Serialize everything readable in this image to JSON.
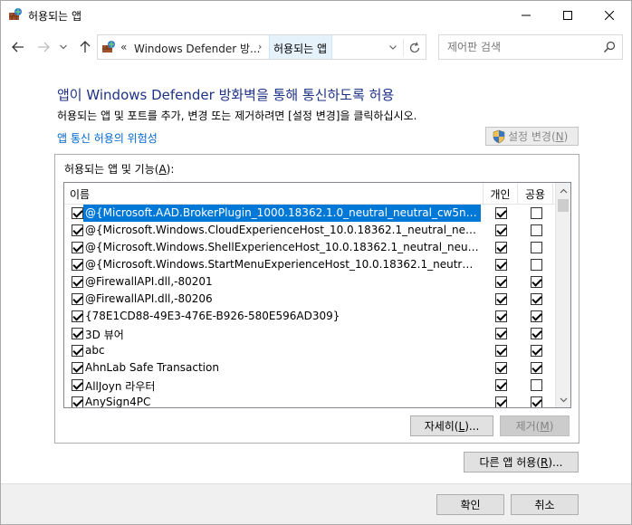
{
  "window": {
    "title": "허용되는 앱",
    "controls": {
      "minimize": "minimize",
      "maximize": "maximize",
      "close": "close"
    }
  },
  "nav": {
    "back_icon": "arrow-left-icon",
    "forward_icon": "arrow-right-icon",
    "up_icon": "arrow-up-icon"
  },
  "address": {
    "overflow": "«",
    "segment1": "Windows Defender 방...",
    "separator": "›",
    "segment2": "허용되는 앱"
  },
  "search": {
    "placeholder": "제어판 검색"
  },
  "content": {
    "heading": "앱이 Windows Defender 방화벽을 통해 통신하도록 허용",
    "subtext": "허용되는 앱 및 포트를 추가, 변경 또는 제거하려면 [설정 변경]을 클릭하십시오.",
    "risk_link": "앱 통신 허용의 위험성",
    "change_settings": {
      "label": "설정 변경(",
      "key": "N",
      "suffix": ")"
    },
    "group_label": {
      "label": "허용되는 앱 및 기능(",
      "key": "A",
      "suffix": "):"
    }
  },
  "table": {
    "columns": {
      "name": "이름",
      "private": "개인",
      "public": "공용"
    },
    "rows": [
      {
        "enabled": true,
        "name": "@{Microsoft.AAD.BrokerPlugin_1000.18362.1.0_neutral_neutral_cw5n1h2txyew...",
        "private": true,
        "public": false,
        "selected": true
      },
      {
        "enabled": true,
        "name": "@{Microsoft.Windows.CloudExperienceHost_10.0.18362.1_neutral_neutral_cw5...",
        "private": true,
        "public": false
      },
      {
        "enabled": true,
        "name": "@{Microsoft.Windows.ShellExperienceHost_10.0.18362.1_neutral_neutral_cw5n...",
        "private": true,
        "public": false
      },
      {
        "enabled": true,
        "name": "@{Microsoft.Windows.StartMenuExperienceHost_10.0.18362.1_neutral_neutral_...",
        "private": true,
        "public": false
      },
      {
        "enabled": true,
        "name": "@FirewallAPI.dll,-80201",
        "private": true,
        "public": true
      },
      {
        "enabled": true,
        "name": "@FirewallAPI.dll,-80206",
        "private": true,
        "public": true
      },
      {
        "enabled": true,
        "name": "{78E1CD88-49E3-476E-B926-580E596AD309}",
        "private": true,
        "public": true
      },
      {
        "enabled": true,
        "name": "3D 뷰어",
        "private": true,
        "public": true
      },
      {
        "enabled": true,
        "name": "abc",
        "private": true,
        "public": true
      },
      {
        "enabled": true,
        "name": "AhnLab Safe Transaction",
        "private": true,
        "public": true
      },
      {
        "enabled": true,
        "name": "AllJoyn 라우터",
        "private": true,
        "public": false
      },
      {
        "enabled": true,
        "name": "AnySign4PC",
        "private": true,
        "public": true
      }
    ]
  },
  "buttons": {
    "details": {
      "label": "자세히(",
      "key": "L",
      "suffix": ")..."
    },
    "remove": {
      "label": "제거(",
      "key": "M",
      "suffix": ")"
    },
    "allow_other": {
      "label": "다른 앱 허용(",
      "key": "R",
      "suffix": ")..."
    },
    "ok": "확인",
    "cancel": "취소"
  },
  "colors": {
    "heading": "#1e3287",
    "link": "#0066cc",
    "selection": "#0078d7"
  }
}
